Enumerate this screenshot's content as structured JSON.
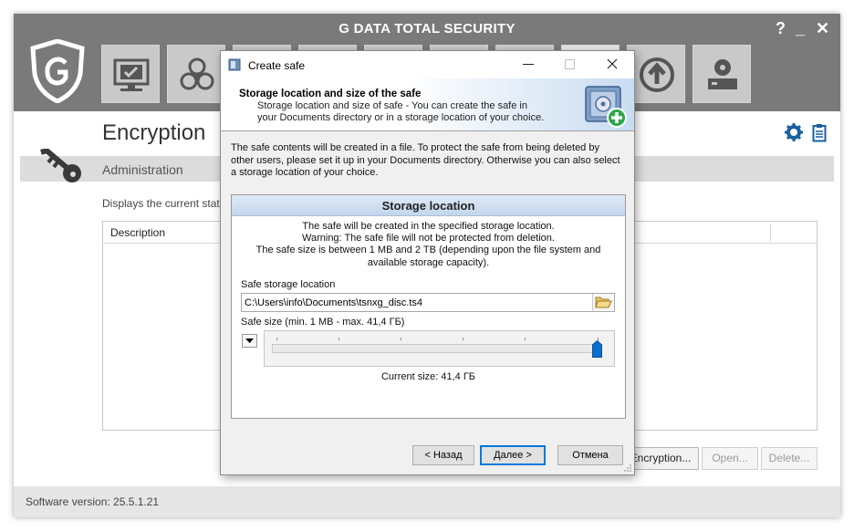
{
  "app": {
    "title": "G DATA TOTAL SECURITY",
    "controls": {
      "help": "?",
      "minimize": "_",
      "close": "✕"
    },
    "nav_tiles": [
      {
        "icon": "monitor-check-icon"
      },
      {
        "icon": "biohazard-icon"
      },
      {
        "icon": "tile-icon"
      },
      {
        "icon": "tile-icon"
      },
      {
        "icon": "tile-icon"
      },
      {
        "icon": "tile-icon"
      },
      {
        "icon": "tile-icon"
      },
      {
        "icon": "upload-circle-icon"
      },
      {
        "icon": "drive-tools-icon"
      }
    ],
    "page_title": "Encryption",
    "section": "Administration",
    "description": "Displays the current status",
    "table": {
      "columns": [
        "Description"
      ]
    },
    "buttons": {
      "new": "Encryption...",
      "open": "Open...",
      "delete": "Delete..."
    },
    "footer": {
      "version": "Software version: 25.5.1.21"
    },
    "colors": {
      "header": "#7a7a7a",
      "tile": "#c9c9c9",
      "accent": "#1a5fa0"
    }
  },
  "dialog": {
    "title": "Create safe",
    "banner": {
      "title": "Storage location and size of the safe",
      "subtitle": "Storage location and size of safe - You can create the safe in your Documents directory or in a storage location of your choice."
    },
    "intro": "The safe contents will be created in a file. To protect the safe from being deleted by other users, please set it up in your Documents directory. Otherwise you can also select a storage location of your choice.",
    "panel": {
      "heading": "Storage location",
      "info_line1": "The safe will be created in the specified storage location.",
      "info_line2": "Warning: The safe file will not be protected from deletion.",
      "info_line3": "The safe size is between 1 MB and 2 TB (depending upon the file system and available storage capacity).",
      "path_label": "Safe storage location",
      "path_value": "C:\\Users\\info\\Documents\\tsnxg_disc.ts4",
      "size_label": "Safe size (min. 1 MB - max. 41,4 ГБ)",
      "slider_fraction": 1.0,
      "current_size": "Current size: 41,4 ГБ"
    },
    "buttons": {
      "back": "< Назад",
      "next": "Далее >",
      "cancel": "Отмена"
    }
  }
}
